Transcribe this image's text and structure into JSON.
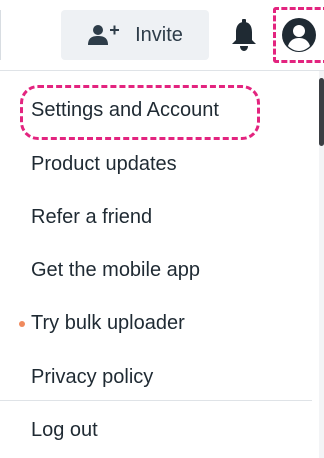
{
  "header": {
    "invite_label": "Invite",
    "invite_icon": "add-user-icon",
    "notification_icon": "bell-icon",
    "account_icon": "user-circle-icon"
  },
  "menu": {
    "items": [
      {
        "label": "Settings and Account",
        "highlighted": true
      },
      {
        "label": "Product updates"
      },
      {
        "label": "Refer a friend"
      },
      {
        "label": "Get the mobile app"
      },
      {
        "label": "Try bulk uploader",
        "badge": "new-dot"
      },
      {
        "label": "Privacy policy"
      },
      {
        "label": "Log out"
      }
    ]
  },
  "colors": {
    "highlight": "#e3247f",
    "text": "#1f2a33",
    "badge_dot": "#f08a5d",
    "invite_bg": "#eef1f4"
  }
}
